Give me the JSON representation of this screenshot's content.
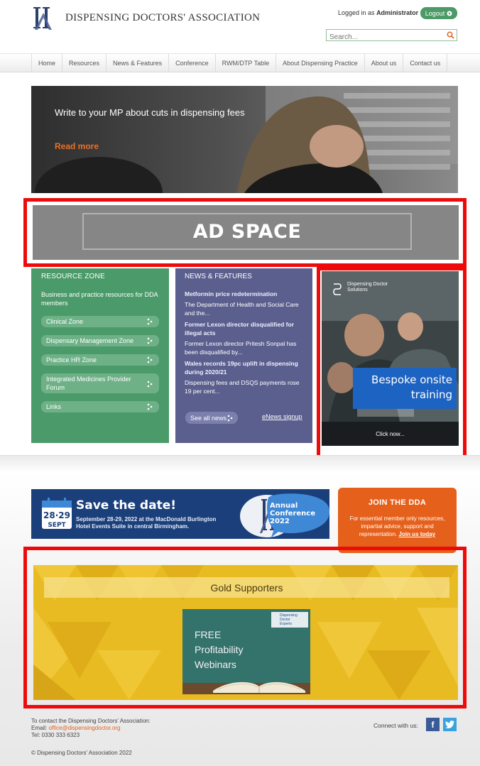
{
  "header": {
    "org_name": "DISPENSING DOCTORS' ASSOCIATION",
    "logged_in_prefix": "Logged in as",
    "logged_in_user": "Administrator",
    "logout_label": "Logout",
    "search_placeholder": "Search..."
  },
  "nav": {
    "items": [
      "Home",
      "Resources",
      "News & Features",
      "Conference",
      "RWM/DTP Table",
      "About Dispensing Practice",
      "About us",
      "Contact us"
    ]
  },
  "hero": {
    "title": "Write to your MP about cuts in dispensing fees",
    "link": "Read more"
  },
  "ad_space": {
    "label": "AD SPACE"
  },
  "resource_zone": {
    "title": "Resource Zone",
    "description": "Business and practice resources for DDA members",
    "links": [
      "Clinical Zone",
      "Dispensary Management Zone",
      "Practice HR Zone",
      "Integrated Medicines Provider Forum",
      "Links"
    ]
  },
  "news": {
    "title": "News & Features",
    "items": [
      {
        "title": "Metformin price redetermination",
        "summary": "The Department of Health and Social Care and the..."
      },
      {
        "title": "Former Lexon director disqualified for illegal acts",
        "summary": "Former Lexon director Pritesh Sonpal has been disqualified by..."
      },
      {
        "title": "Wales records 19pc uplift in dispensing during 2020/21",
        "summary": "Dispensing fees and DSQS payments rose 19 per cent..."
      }
    ],
    "see_all": "See all news",
    "enews": "eNews signup"
  },
  "side_ad": {
    "brand_line1": "Dispensing Doctor",
    "brand_line2": "Solutions",
    "headline_line1": "Bespoke onsite",
    "headline_line2": "training",
    "cta": "Click now..."
  },
  "save_date": {
    "cal_days": "28·29",
    "cal_month": "SEPT",
    "title": "Save the date!",
    "description": "September 28-29, 2022 at the MacDonald Burlington Hotel Events Suite in central Birmingham.",
    "conf_line1": "Annual",
    "conf_line2": "Conference",
    "conf_line3": "2022"
  },
  "join": {
    "title": "JOIN THE DDA",
    "description": "For essential member only resources, impartial advice, support and representation.",
    "link": "Join us today"
  },
  "gold": {
    "title": "Gold Supporters",
    "webinar_line1": "FREE",
    "webinar_line2": "Profitability",
    "webinar_line3": "Webinars",
    "badge_line1": "Dispensing",
    "badge_line2": "Doctor",
    "badge_line3": "Experts"
  },
  "footer": {
    "contact_line": "To contact the Dispensing Doctors' Association:",
    "email_label": "Email:",
    "email": "office@dispensingdoctor.org",
    "tel": "Tel: 0330 333 6323",
    "copyright": "© Dispensing Doctors' Association 2022",
    "connect": "Connect with us:"
  },
  "colors": {
    "brand_green": "#4b9a6a",
    "news_purple": "#5b5f8e",
    "accent_orange": "#e5601b",
    "highlight_red": "#ee0a0a"
  }
}
